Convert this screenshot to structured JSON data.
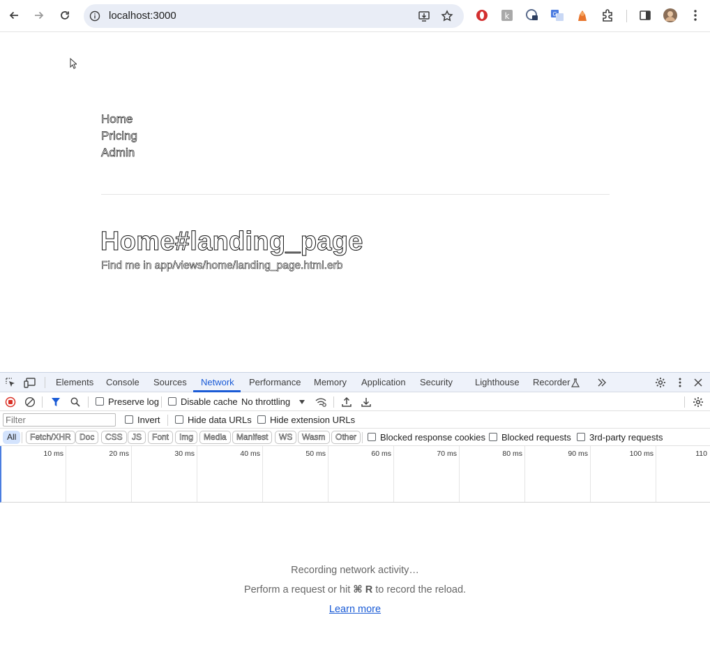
{
  "browser": {
    "url": "localhost:3000"
  },
  "page": {
    "nav_links": [
      "Home",
      "Pricing",
      "Admin"
    ],
    "heading": "Home#landing_page",
    "subtext": "Find me in app/views/home/landing_page.html.erb"
  },
  "devtools": {
    "tabs": [
      "Elements",
      "Console",
      "Sources",
      "Network",
      "Performance",
      "Memory",
      "Application",
      "Security",
      "Lighthouse",
      "Recorder"
    ],
    "active_tab": "Network",
    "toolbar": {
      "preserve_log": "Preserve log",
      "disable_cache": "Disable cache",
      "throttling": "No throttling"
    },
    "filter_bar": {
      "placeholder": "Filter",
      "invert": "Invert",
      "hide_data_urls": "Hide data URLs",
      "hide_extension_urls": "Hide extension URLs"
    },
    "type_filters": [
      "All",
      "Fetch/XHR",
      "Doc",
      "CSS",
      "JS",
      "Font",
      "Img",
      "Media",
      "Manifest",
      "WS",
      "Wasm",
      "Other"
    ],
    "active_type_filter": "All",
    "extra_filters": {
      "blocked_response_cookies": "Blocked response cookies",
      "blocked_requests": "Blocked requests",
      "third_party_requests": "3rd-party requests"
    },
    "timeline_ticks": [
      "10 ms",
      "20 ms",
      "30 ms",
      "40 ms",
      "50 ms",
      "60 ms",
      "70 ms",
      "80 ms",
      "90 ms",
      "100 ms",
      "110"
    ],
    "empty_state": {
      "line1": "Recording network activity…",
      "line2_before": "Perform a request or hit ",
      "line2_key": "⌘ R",
      "line2_after": " to record the reload.",
      "learn_more": "Learn more"
    }
  },
  "colors": {
    "accent": "#1a5bd6",
    "record_red": "#d93025",
    "chip_active_bg": "#d3e3fd"
  },
  "icons": [
    "back-arrow-icon",
    "forward-arrow-icon",
    "reload-icon",
    "site-info-icon",
    "install-app-icon",
    "bookmark-star-icon",
    "extension-opera-icon",
    "extension-k-icon",
    "extension-lock-icon",
    "extension-translate-icon",
    "extension-fox-icon",
    "extensions-puzzle-icon",
    "side-panel-icon",
    "profile-avatar",
    "browser-menu-icon"
  ]
}
